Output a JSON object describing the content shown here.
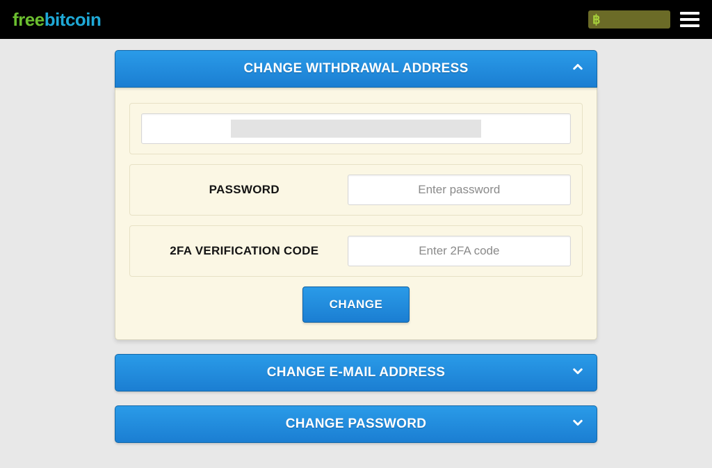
{
  "brand": {
    "part1": "free",
    "part2": "bitcoin"
  },
  "topbar": {
    "balance_symbol": "฿"
  },
  "panels": {
    "withdrawal": {
      "title": "CHANGE WITHDRAWAL ADDRESS",
      "address_value": "",
      "password_label": "PASSWORD",
      "password_placeholder": "Enter password",
      "tfa_label": "2FA VERIFICATION CODE",
      "tfa_placeholder": "Enter 2FA code",
      "button": "CHANGE"
    },
    "email": {
      "title": "CHANGE E-MAIL ADDRESS"
    },
    "password": {
      "title": "CHANGE PASSWORD"
    }
  }
}
